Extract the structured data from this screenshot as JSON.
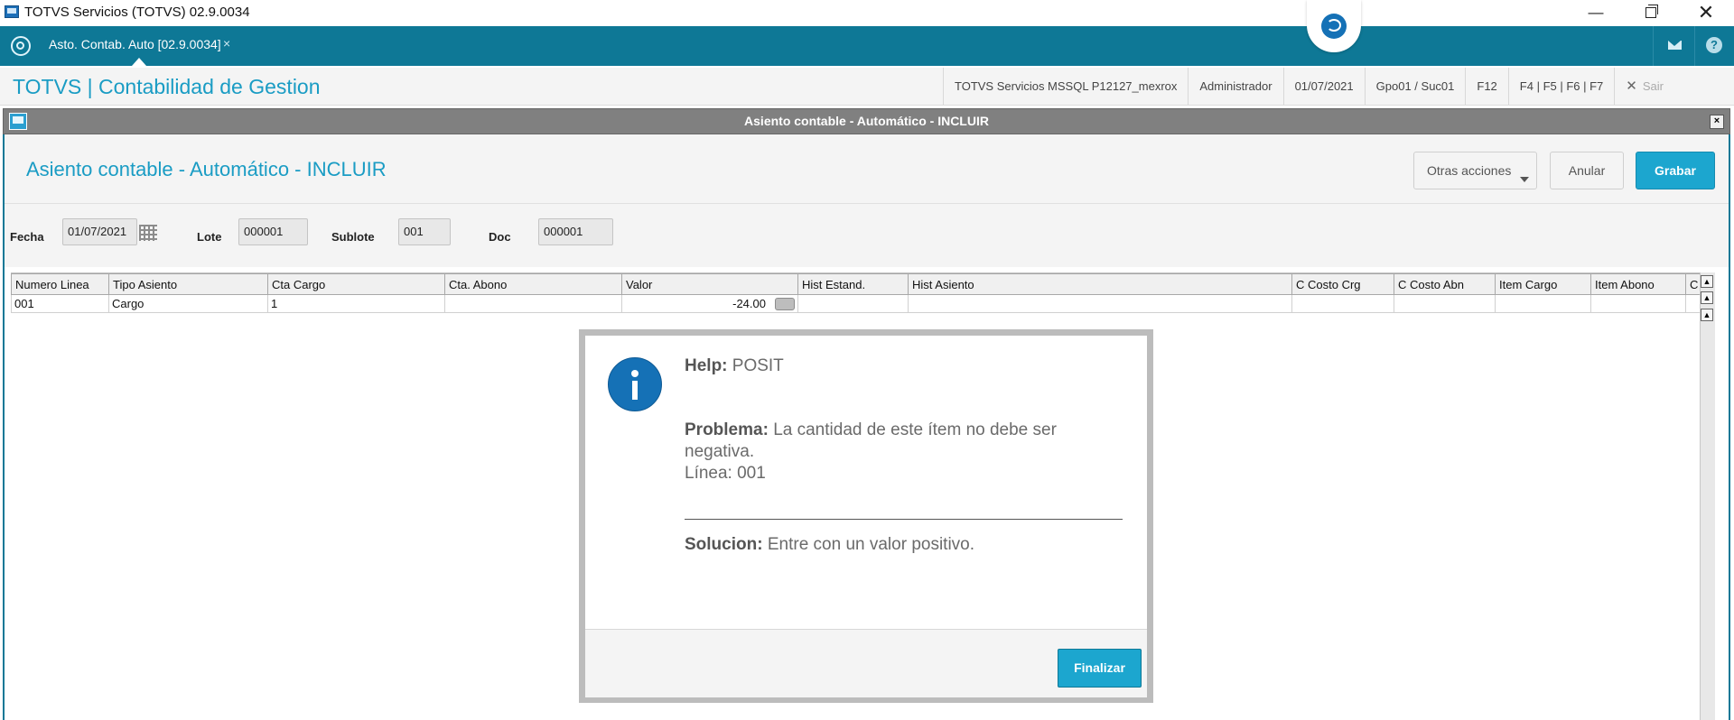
{
  "os_window": {
    "title": "TOTVS Servicios (TOTVS) 02.9.0034",
    "minimize": "—",
    "close": "✕"
  },
  "app_bar": {
    "tab_label": "Asto. Contab. Auto [02.9.0034]",
    "tab_close": "×",
    "help": "?"
  },
  "module": {
    "title": "TOTVS | Contabilidad de Gestion",
    "status": [
      "TOTVS Servicios MSSQL P12127_mexrox",
      "Administrador",
      "01/07/2021",
      "Gpo01 / Suc01",
      "F12",
      "F4 | F5 | F6 | F7"
    ],
    "exit": "Sair"
  },
  "dialog": {
    "window_title": "Asiento contable - Automático - INCLUIR",
    "close": "×",
    "heading": "Asiento contable - Automático - INCLUIR",
    "buttons": {
      "otras": "Otras acciones",
      "anular": "Anular",
      "grabar": "Grabar"
    }
  },
  "form": {
    "fecha_label": "Fecha",
    "fecha_value": "01/07/2021",
    "lote_label": "Lote",
    "lote_value": "000001",
    "sublote_label": "Sublote",
    "sublote_value": "001",
    "doc_label": "Doc",
    "doc_value": "000001"
  },
  "grid": {
    "columns": [
      "Numero Linea",
      "Tipo Asiento",
      "Cta Cargo",
      "Cta. Abono",
      "Valor",
      "Hist Estand.",
      "Hist Asiento",
      "C Costo Crg",
      "C Costo Abn",
      "Item Cargo",
      "Item Abono",
      "C"
    ],
    "rows": [
      [
        "001",
        "Cargo",
        "1",
        "",
        "-24.00",
        "",
        "",
        "",
        "",
        "",
        "",
        ""
      ]
    ]
  },
  "help_dialog": {
    "help_label": "Help:",
    "help_value": "POSIT",
    "problema_label": "Problema:",
    "problema_text": "La cantidad de este ítem no debe ser",
    "problema_text2": "negativa.",
    "linea": "Línea: 001",
    "solucion_label": "Solucion:",
    "solucion_text": "Entre con un valor positivo.",
    "finalizar": "Finalizar"
  },
  "colors": {
    "app_bar": "#0e7896",
    "accent": "#1a9cc4",
    "primary_button": "#1ca6cf",
    "dialog_titlebar": "#808080",
    "info_icon": "#1571b6"
  }
}
